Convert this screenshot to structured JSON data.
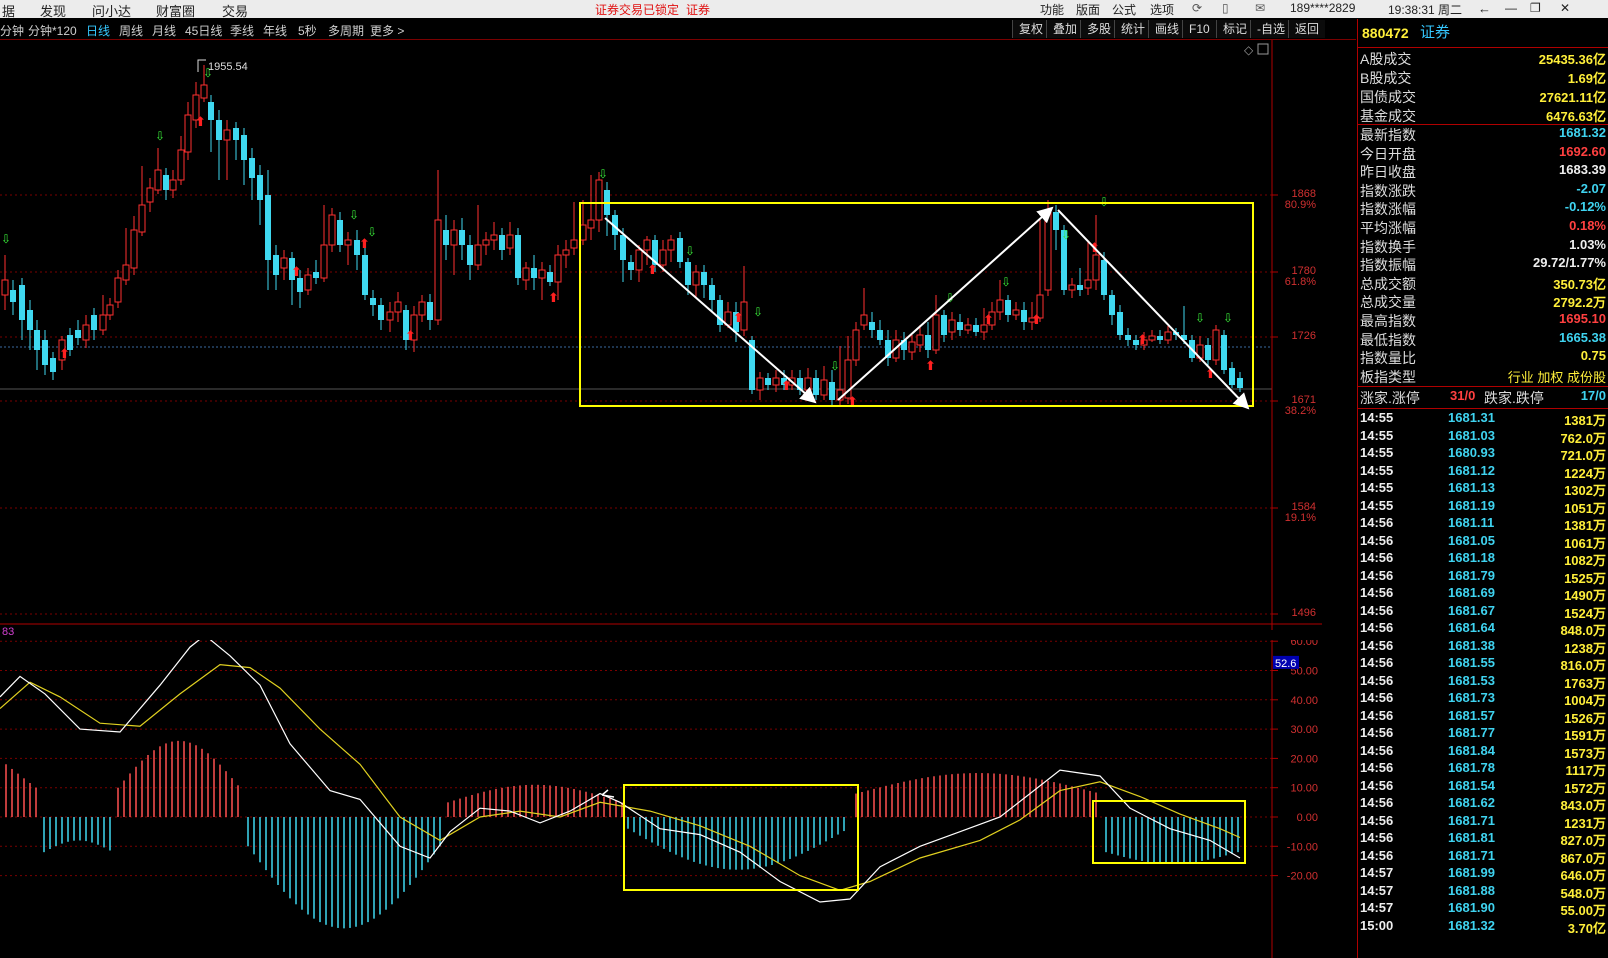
{
  "top_menu": [
    "据",
    "发现",
    "问小达",
    "财富圈",
    "交易"
  ],
  "lock_notice": "证券交易已锁定",
  "lock_suffix": "证券",
  "top_controls": [
    "功能",
    "版面",
    "公式",
    "选项"
  ],
  "user_id": "189****2829",
  "clock": "19:38:31 周二",
  "periods": [
    "分钟",
    "分钟*120",
    "日线",
    "周线",
    "月线",
    "45日线",
    "季线",
    "年线",
    "5秒",
    "多周期",
    "更多 >"
  ],
  "active_period": "日线",
  "toolbar": [
    "复权",
    "叠加",
    "多股",
    "统计",
    "画线",
    "F10",
    "标记",
    "-自选",
    "返回"
  ],
  "main_chart": {
    "high_label": "1955.54",
    "price_axis": [
      {
        "label": "1868",
        "pct": "80.9%"
      },
      {
        "label": "1780",
        "pct": "61.8%"
      },
      {
        "label": "1726",
        "pct": ""
      },
      {
        "label": "1671",
        "pct": "38.2%"
      },
      {
        "label": "1584",
        "pct": "19.1%"
      },
      {
        "label": "1496",
        "pct": ""
      }
    ]
  },
  "indicator": {
    "code_label": "83",
    "current_value": "52.6",
    "axis": [
      "60.00",
      "50.00",
      "40.00",
      "30.00",
      "20.00",
      "10.00",
      "0.00",
      "-10.00",
      "-20.00"
    ]
  },
  "right_panel": {
    "code": "880472",
    "name": "证券",
    "market_rows": [
      {
        "label": "A股成交",
        "value": "25435.36亿",
        "color": "#ffef3a"
      },
      {
        "label": "B股成交",
        "value": "1.69亿",
        "color": "#ffef3a"
      },
      {
        "label": "国债成交",
        "value": "27621.11亿",
        "color": "#ffef3a"
      },
      {
        "label": "基金成交",
        "value": "6476.63亿",
        "color": "#ffef3a"
      }
    ],
    "stat_rows": [
      {
        "label": "最新指数",
        "value": "1681.32",
        "color": "#3fd3f0"
      },
      {
        "label": "今日开盘",
        "value": "1692.60",
        "color": "#ff4040"
      },
      {
        "label": "昨日收盘",
        "value": "1683.39",
        "color": "#eeeeee"
      },
      {
        "label": "指数涨跌",
        "value": "-2.07",
        "color": "#3fd3f0"
      },
      {
        "label": "指数涨幅",
        "value": "-0.12%",
        "color": "#3fd3f0"
      },
      {
        "label": "平均涨幅",
        "value": "0.18%",
        "color": "#ff4040"
      },
      {
        "label": "指数换手",
        "value": "1.03%",
        "color": "#eeeeee"
      },
      {
        "label": "指数振幅",
        "value": "29.72/1.77%",
        "color": "#eeeeee"
      },
      {
        "label": "总成交额",
        "value": "350.73亿",
        "color": "#ffef3a"
      },
      {
        "label": "总成交量",
        "value": "2792.2万",
        "color": "#ffef3a"
      },
      {
        "label": "最高指数",
        "value": "1695.10",
        "color": "#ff4040"
      },
      {
        "label": "最低指数",
        "value": "1665.38",
        "color": "#3fd3f0"
      },
      {
        "label": "指数量比",
        "value": "0.75",
        "color": "#ffef3a"
      }
    ],
    "board_type_label": "板指类型",
    "board_type_value": "行业 加权 成份股",
    "adv_label": "涨家.涨停",
    "adv_value": "31/0",
    "dec_label": "跌家.跌停",
    "dec_value": "17/0",
    "ticks": [
      [
        "14:55",
        "1681.31",
        "1381万"
      ],
      [
        "14:55",
        "1681.03",
        "762.0万"
      ],
      [
        "14:55",
        "1680.93",
        "721.0万"
      ],
      [
        "14:55",
        "1681.12",
        "1224万"
      ],
      [
        "14:55",
        "1681.13",
        "1302万"
      ],
      [
        "14:55",
        "1681.19",
        "1051万"
      ],
      [
        "14:56",
        "1681.11",
        "1381万"
      ],
      [
        "14:56",
        "1681.05",
        "1061万"
      ],
      [
        "14:56",
        "1681.18",
        "1082万"
      ],
      [
        "14:56",
        "1681.79",
        "1525万"
      ],
      [
        "14:56",
        "1681.69",
        "1490万"
      ],
      [
        "14:56",
        "1681.67",
        "1524万"
      ],
      [
        "14:56",
        "1681.64",
        "848.0万"
      ],
      [
        "14:56",
        "1681.38",
        "1238万"
      ],
      [
        "14:56",
        "1681.55",
        "816.0万"
      ],
      [
        "14:56",
        "1681.53",
        "1763万"
      ],
      [
        "14:56",
        "1681.73",
        "1004万"
      ],
      [
        "14:56",
        "1681.57",
        "1526万"
      ],
      [
        "14:56",
        "1681.77",
        "1591万"
      ],
      [
        "14:56",
        "1681.84",
        "1573万"
      ],
      [
        "14:56",
        "1681.78",
        "1117万"
      ],
      [
        "14:56",
        "1681.54",
        "1572万"
      ],
      [
        "14:56",
        "1681.62",
        "843.0万"
      ],
      [
        "14:56",
        "1681.71",
        "1231万"
      ],
      [
        "14:56",
        "1681.81",
        "827.0万"
      ],
      [
        "14:56",
        "1681.71",
        "867.0万"
      ],
      [
        "14:57",
        "1681.99",
        "646.0万"
      ],
      [
        "14:57",
        "1681.88",
        "548.0万"
      ],
      [
        "14:57",
        "1681.90",
        "55.00万"
      ],
      [
        "15:00",
        "1681.32",
        "3.70亿"
      ]
    ]
  },
  "colors": {
    "up": "#ff3030",
    "down": "#3fd8f0",
    "highlight": "#ffff00",
    "grid": "#7a0000"
  }
}
